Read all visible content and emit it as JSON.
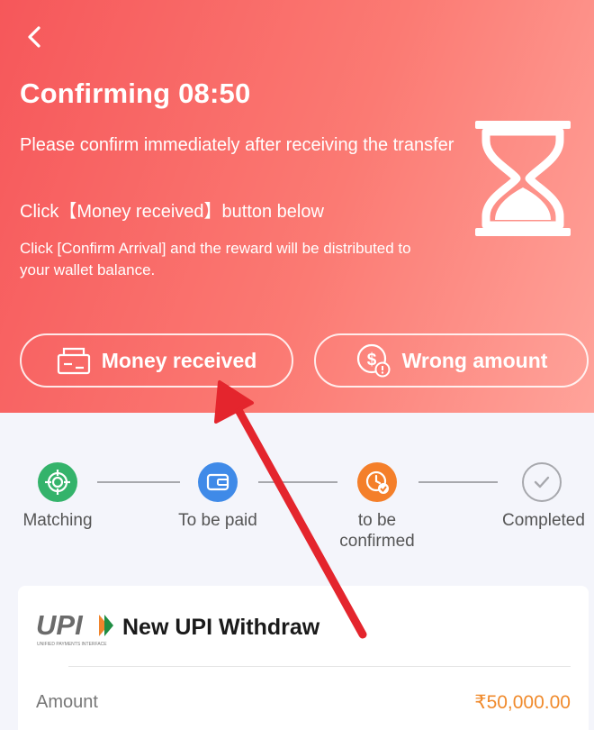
{
  "header": {
    "title": "Confirming 08:50",
    "desc_line1": "Please confirm immediately after receiving the transfer",
    "desc_line2": "Click【Money received】button below",
    "desc_line3": "Click [Confirm Arrival] and the reward will be distributed to your wallet balance.",
    "background_start": "#f6575a",
    "background_end": "#ffa39a"
  },
  "actions": {
    "money_received_label": "Money received",
    "wrong_amount_label": "Wrong amount"
  },
  "steps": [
    {
      "label": "Matching",
      "color": "#34b36b",
      "icon": "target-icon"
    },
    {
      "label": "To be paid",
      "color": "#3f8ae8",
      "icon": "wallet-icon"
    },
    {
      "label": "to be confirmed",
      "color": "#f47f2a",
      "icon": "clock-check-icon"
    },
    {
      "label": "Completed",
      "color": "#a7a8ad",
      "icon": "check-circle-icon"
    }
  ],
  "card": {
    "logo_text": "UPI",
    "logo_subtext": "UNIFIED PAYMENTS INTERFACE",
    "title": "New UPI Withdraw",
    "amount_label": "Amount",
    "amount_value": "₹50,000.00",
    "amount_color": "#f08a2c"
  },
  "annotation": {
    "arrow_color": "#e4252d"
  }
}
